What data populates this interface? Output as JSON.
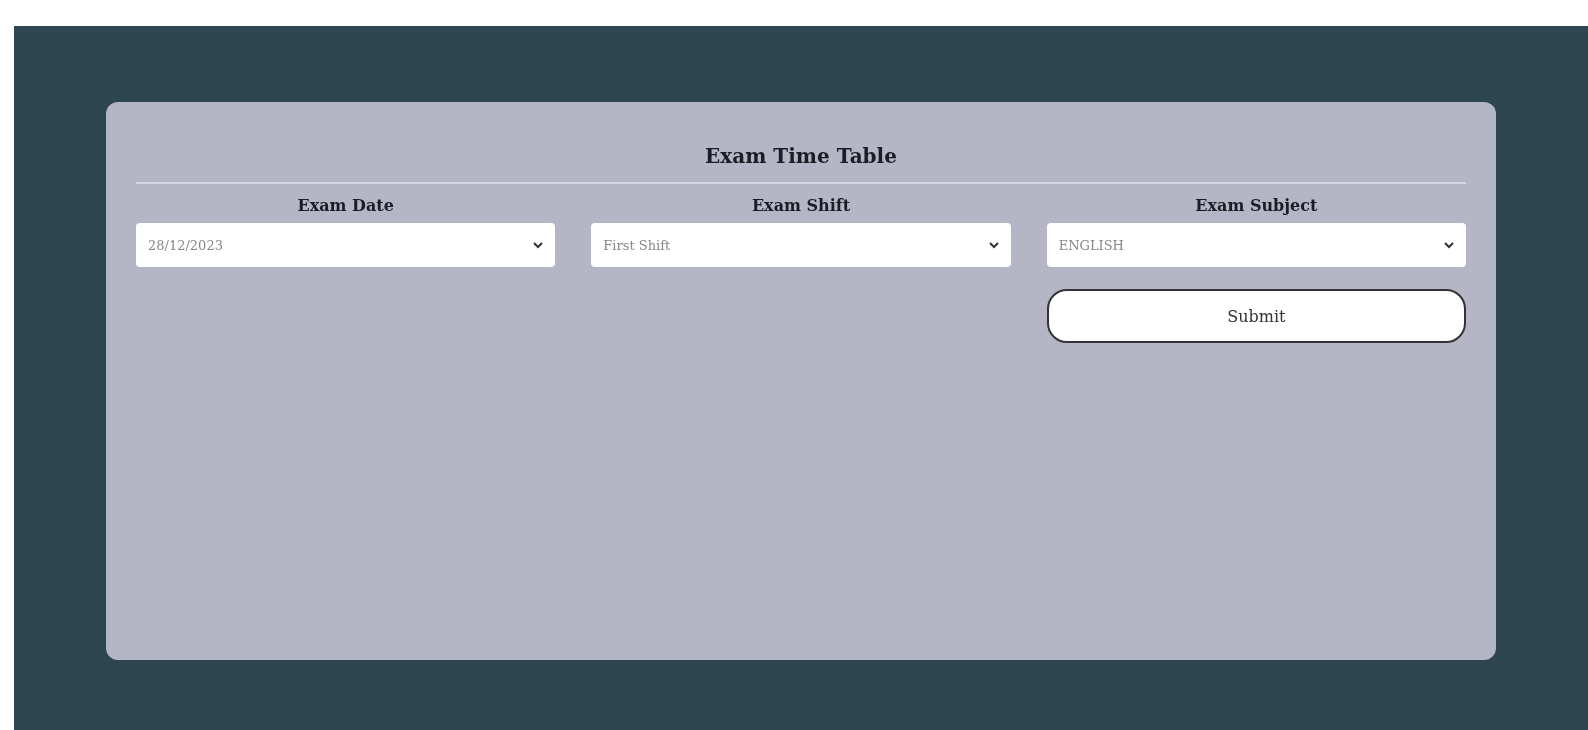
{
  "card": {
    "title": "Exam Time Table"
  },
  "fields": [
    {
      "label": "Exam Date",
      "value": "28/12/2023"
    },
    {
      "label": "Exam Shift",
      "value": "First Shift"
    },
    {
      "label": "Exam Subject",
      "value": "ENGLISH"
    }
  ],
  "buttons": [
    "Submit"
  ]
}
